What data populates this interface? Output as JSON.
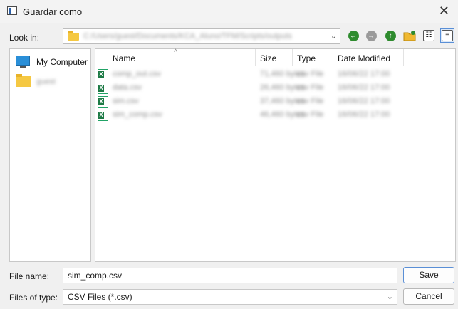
{
  "window": {
    "title": "Guardar como",
    "close_glyph": "✕"
  },
  "lookin": {
    "label": "Look in:",
    "path": "C:/Users/guest/Documents/KCA_Aluno/TFM/Scripts/outputs",
    "arrow": "⌄"
  },
  "toolbar": {
    "back_glyph": "←",
    "forward_glyph": "→",
    "up_glyph": "↑",
    "list_glyph": "≡",
    "detail_glyph": "☷",
    "colors": {
      "back": "#2e8b2e",
      "forward": "#9a9a9a",
      "up": "#2e8b2e"
    }
  },
  "sidebar": {
    "items": [
      {
        "label": "My Computer",
        "icon": "monitor-icon"
      },
      {
        "label": "guest",
        "icon": "folder-icon"
      }
    ]
  },
  "files": {
    "columns": [
      "Name",
      "Size",
      "Type",
      "Date Modified"
    ],
    "sort_glyph": "^",
    "rows": [
      {
        "name": "comp_out.csv",
        "size": "71,460 bytes",
        "type": "csv File",
        "date": "16/06/22 17:00"
      },
      {
        "name": "data.csv",
        "size": "26,460 bytes",
        "type": "csv File",
        "date": "16/06/22 17:00"
      },
      {
        "name": "sim.csv",
        "size": "37,460 bytes",
        "type": "csv File",
        "date": "16/06/22 17:00"
      },
      {
        "name": "sim_comp.csv",
        "size": "46,460 bytes",
        "type": "csv File",
        "date": "16/06/22 17:00"
      }
    ]
  },
  "bottom": {
    "filename_label": "File name:",
    "filename_value": "sim_comp.csv",
    "filetype_label": "Files of type:",
    "filetype_value": "CSV Files (*.csv)",
    "save_label": "Save",
    "cancel_label": "Cancel",
    "dropdown_glyph": "⌄"
  }
}
